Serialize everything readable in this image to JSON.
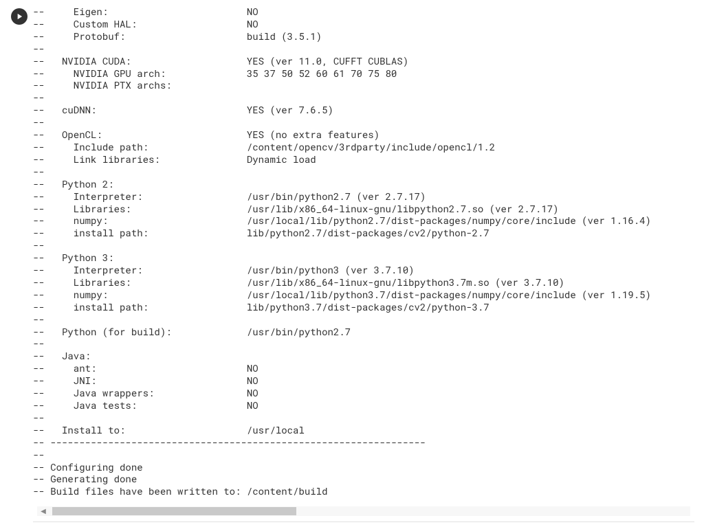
{
  "output_lines": [
    "--     Eigen:                        NO",
    "--     Custom HAL:                   NO",
    "--     Protobuf:                     build (3.5.1)",
    "--",
    "--   NVIDIA CUDA:                    YES (ver 11.0, CUFFT CUBLAS)",
    "--     NVIDIA GPU arch:              35 37 50 52 60 61 70 75 80",
    "--     NVIDIA PTX archs:",
    "--",
    "--   cuDNN:                          YES (ver 7.6.5)",
    "--",
    "--   OpenCL:                         YES (no extra features)",
    "--     Include path:                 /content/opencv/3rdparty/include/opencl/1.2",
    "--     Link libraries:               Dynamic load",
    "--",
    "--   Python 2:",
    "--     Interpreter:                  /usr/bin/python2.7 (ver 2.7.17)",
    "--     Libraries:                    /usr/lib/x86_64-linux-gnu/libpython2.7.so (ver 2.7.17)",
    "--     numpy:                        /usr/local/lib/python2.7/dist-packages/numpy/core/include (ver 1.16.4)",
    "--     install path:                 lib/python2.7/dist-packages/cv2/python-2.7",
    "--",
    "--   Python 3:",
    "--     Interpreter:                  /usr/bin/python3 (ver 3.7.10)",
    "--     Libraries:                    /usr/lib/x86_64-linux-gnu/libpython3.7m.so (ver 3.7.10)",
    "--     numpy:                        /usr/local/lib/python3.7/dist-packages/numpy/core/include (ver 1.19.5)",
    "--     install path:                 lib/python3.7/dist-packages/cv2/python-3.7",
    "--",
    "--   Python (for build):             /usr/bin/python2.7",
    "--",
    "--   Java:",
    "--     ant:                          NO",
    "--     JNI:                          NO",
    "--     Java wrappers:                NO",
    "--     Java tests:                   NO",
    "--",
    "--   Install to:                     /usr/local",
    "-- -----------------------------------------------------------------",
    "--",
    "-- Configuring done",
    "-- Generating done",
    "-- Build files have been written to: /content/build"
  ],
  "scroll": {
    "left_arrow": "◀",
    "right_arrow": ""
  },
  "cmake_summary": {
    "Eigen": "NO",
    "Custom HAL": "NO",
    "Protobuf": "build (3.5.1)",
    "NVIDIA CUDA": "YES (ver 11.0, CUFFT CUBLAS)",
    "NVIDIA GPU arch": "35 37 50 52 60 61 70 75 80",
    "NVIDIA PTX archs": "",
    "cuDNN": "YES (ver 7.6.5)",
    "OpenCL": "YES (no extra features)",
    "OpenCL Include path": "/content/opencv/3rdparty/include/opencl/1.2",
    "OpenCL Link libraries": "Dynamic load",
    "Python 2 Interpreter": "/usr/bin/python2.7 (ver 2.7.17)",
    "Python 2 Libraries": "/usr/lib/x86_64-linux-gnu/libpython2.7.so (ver 2.7.17)",
    "Python 2 numpy": "/usr/local/lib/python2.7/dist-packages/numpy/core/include (ver 1.16.4)",
    "Python 2 install path": "lib/python2.7/dist-packages/cv2/python-2.7",
    "Python 3 Interpreter": "/usr/bin/python3 (ver 3.7.10)",
    "Python 3 Libraries": "/usr/lib/x86_64-linux-gnu/libpython3.7m.so (ver 3.7.10)",
    "Python 3 numpy": "/usr/local/lib/python3.7/dist-packages/numpy/core/include (ver 1.19.5)",
    "Python 3 install path": "lib/python3.7/dist-packages/cv2/python-3.7",
    "Python (for build)": "/usr/bin/python2.7",
    "Java ant": "NO",
    "Java JNI": "NO",
    "Java wrappers": "NO",
    "Java tests": "NO",
    "Install to": "/usr/local",
    "status": [
      "Configuring done",
      "Generating done",
      "Build files have been written to: /content/build"
    ]
  }
}
